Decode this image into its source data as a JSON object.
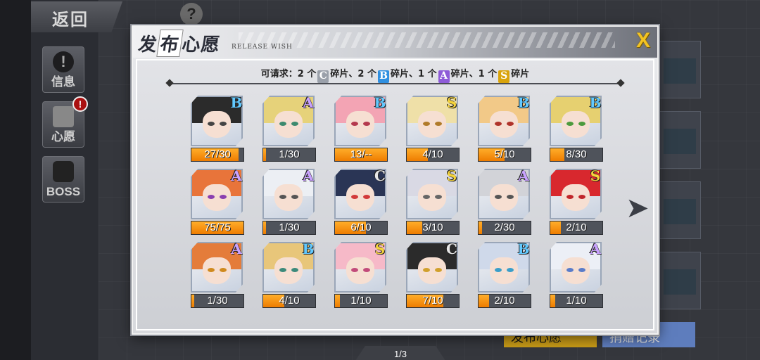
{
  "background": {
    "back_label": "返回",
    "help_glyph": "?",
    "side_buttons": [
      {
        "label": "信息",
        "glyph": "!"
      },
      {
        "label": "心愿",
        "glyph": "",
        "badge": "!"
      },
      {
        "label": "BOSS",
        "glyph": ""
      }
    ],
    "bottom_buttons": [
      "发布心愿",
      "捐赠记录"
    ]
  },
  "dialog": {
    "title_chars": [
      "发",
      "布",
      "心",
      "愿"
    ],
    "subtitle": "RELEASE WISH",
    "close_label": "X",
    "request_text": {
      "prefix": "可请求：",
      "items": [
        {
          "count": "2 个",
          "grade": "C",
          "unit": "碎片"
        },
        {
          "count": "2 个",
          "grade": "B",
          "unit": "碎片"
        },
        {
          "count": "1 个",
          "grade": "A",
          "unit": "碎片"
        },
        {
          "count": "1 个",
          "grade": "S",
          "unit": "碎片"
        }
      ]
    },
    "cards": [
      {
        "grade": "B",
        "progress": "27/30",
        "fill": 0.9
      },
      {
        "grade": "A",
        "progress": "1/30",
        "fill": 0.033
      },
      {
        "grade": "B",
        "progress": "13/--",
        "fill": 1.0
      },
      {
        "grade": "S",
        "progress": "4/10",
        "fill": 0.4
      },
      {
        "grade": "B",
        "progress": "5/10",
        "fill": 0.5
      },
      {
        "grade": "B",
        "progress": "8/30",
        "fill": 0.267
      },
      {
        "grade": "A",
        "progress": "75/75",
        "fill": 1.0
      },
      {
        "grade": "A",
        "progress": "1/30",
        "fill": 0.033
      },
      {
        "grade": "C",
        "progress": "6/10",
        "fill": 0.6
      },
      {
        "grade": "S",
        "progress": "3/10",
        "fill": 0.3
      },
      {
        "grade": "A",
        "progress": "2/30",
        "fill": 0.067
      },
      {
        "grade": "S",
        "progress": "2/10",
        "fill": 0.2
      },
      {
        "grade": "A",
        "progress": "1/30",
        "fill": 0.033
      },
      {
        "grade": "B",
        "progress": "4/10",
        "fill": 0.4
      },
      {
        "grade": "S",
        "progress": "1/10",
        "fill": 0.1
      },
      {
        "grade": "C",
        "progress": "7/10",
        "fill": 0.7
      },
      {
        "grade": "B",
        "progress": "2/10",
        "fill": 0.2
      },
      {
        "grade": "A",
        "progress": "1/10",
        "fill": 0.1
      }
    ],
    "next_icon": "next-page-arrow-icon",
    "page_indicator": "1/3"
  },
  "colors": {
    "progress_fill": "#f08a00",
    "grade_S": "#f5d33b",
    "grade_A": "#c9a2ff",
    "grade_B": "#62c9ff",
    "grade_C": "#e7e7e7",
    "close": "#f3c321"
  }
}
